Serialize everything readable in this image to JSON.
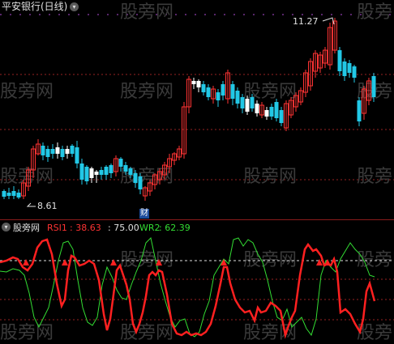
{
  "upper_panel": {
    "title": "平安银行(日线)",
    "high_marker": "11.27",
    "low_marker": "8.61",
    "event_badge": "财"
  },
  "lower_panel": {
    "name": "股旁网",
    "rsi1_label": "RSI1",
    "rsi1_value": ": 38.63",
    "level_value": ": 75.00",
    "wr2_label": "WR2",
    "wr2_value": ": 62.39"
  },
  "watermark": "股旁网",
  "colors": {
    "up": "#ff3333",
    "down": "#22c8e6",
    "doji": "#ffffff",
    "rsi": "#ff2020",
    "wr": "#33dd33",
    "grid": "#992222",
    "label_white": "#e0e0e0"
  }
}
